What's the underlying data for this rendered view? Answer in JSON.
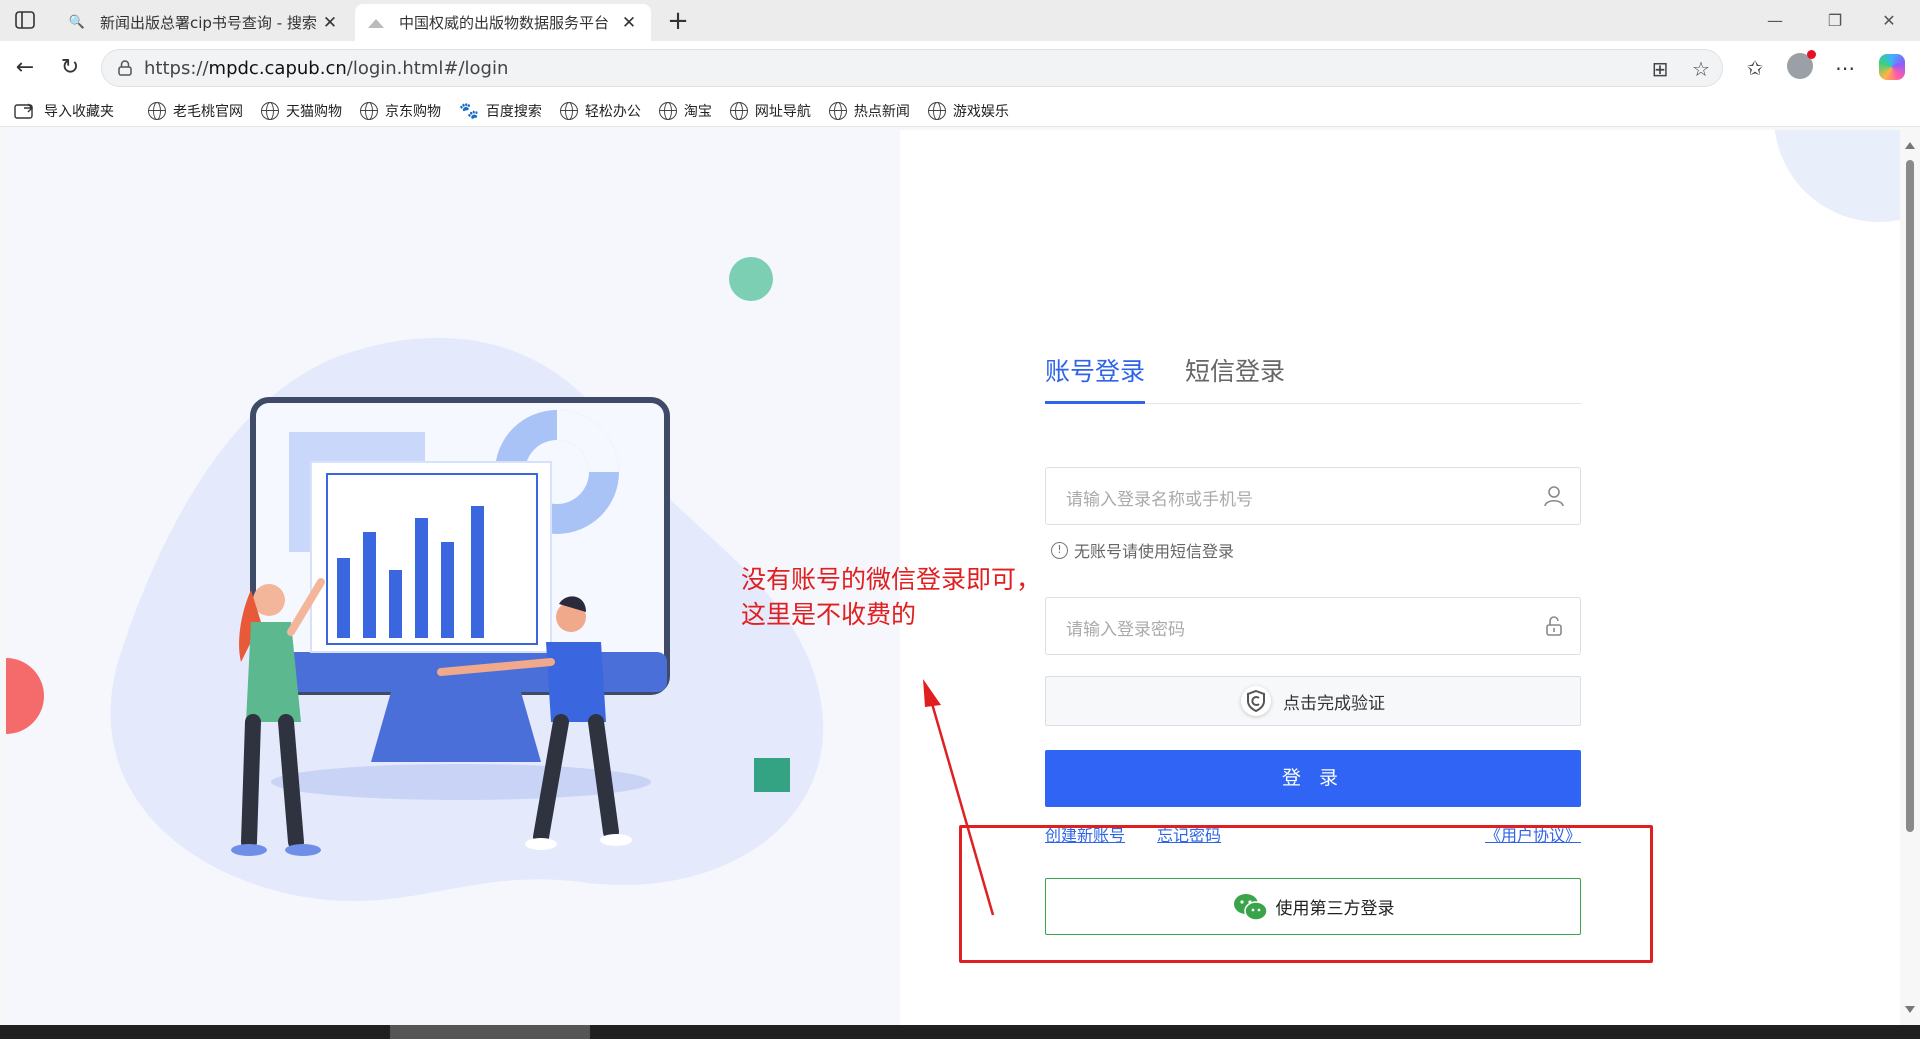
{
  "browser": {
    "tabs": [
      {
        "title": "新闻出版总署cip书号查询 - 搜索",
        "active": false
      },
      {
        "title": "中国权威的出版物数据服务平台",
        "active": true
      }
    ],
    "url_prefix": "https://",
    "url_host": "mpdc.capub.cn",
    "url_path": "/login.html#/login",
    "bookmarks": [
      "导入收藏夹",
      "老毛桃官网",
      "天猫购物",
      "京东购物",
      "百度搜索",
      "轻松办公",
      "淘宝",
      "网址导航",
      "热点新闻",
      "游戏娱乐"
    ]
  },
  "login": {
    "tab_account": "账号登录",
    "tab_sms": "短信登录",
    "username_placeholder": "请输入登录名称或手机号",
    "hint": "无账号请使用短信登录",
    "password_placeholder": "请输入登录密码",
    "verify_label": "点击完成验证",
    "login_button": "登 录",
    "link_register": "创建新账号",
    "link_forgot": "忘记密码",
    "link_agreement": "《用户协议》",
    "third_party": "使用第三方登录"
  },
  "annotation": {
    "line1": "没有账号的微信登录即可，",
    "line2": "这里是不收费的"
  },
  "colors": {
    "primary": "#2f64f5",
    "annotation": "#e02020",
    "wechat": "#3aa44a"
  }
}
